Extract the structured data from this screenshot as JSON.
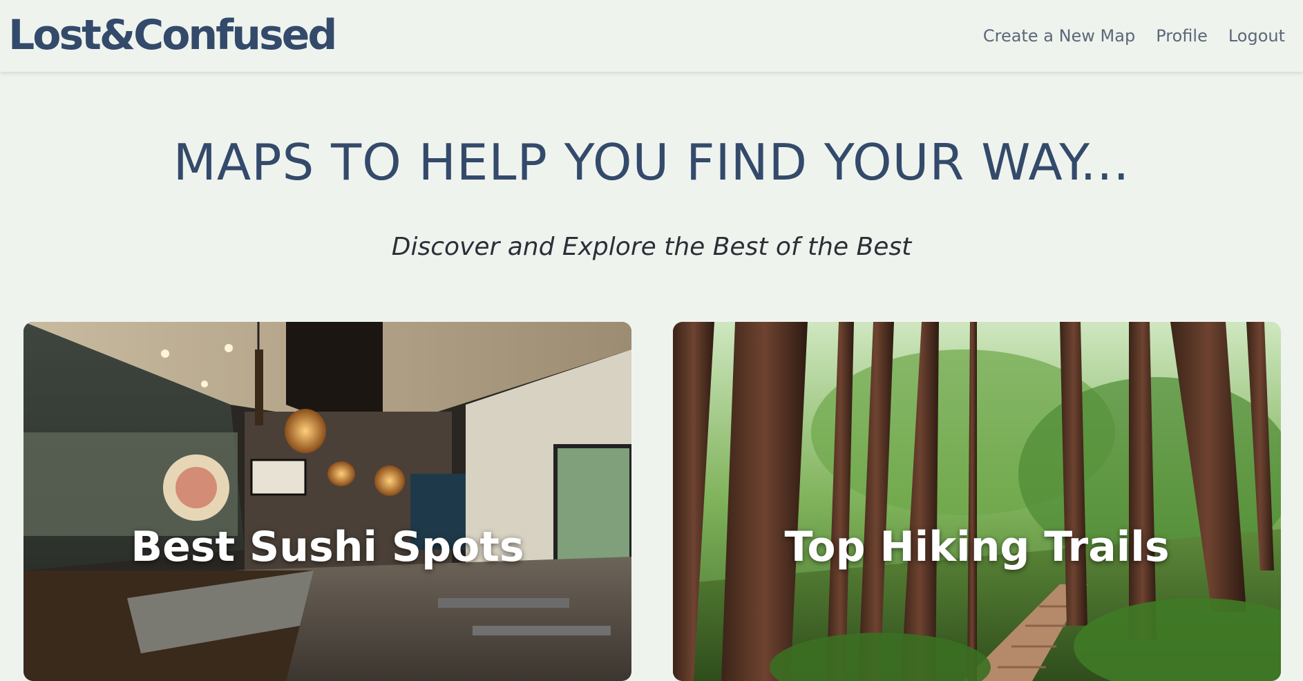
{
  "header": {
    "brand": "Lost&Confused",
    "nav": [
      {
        "label": "Create a New Map"
      },
      {
        "label": "Profile"
      },
      {
        "label": "Logout"
      }
    ]
  },
  "hero": {
    "title": "MAPS TO HELP YOU FIND YOUR WAY...",
    "subtitle": "Discover and Explore the Best of the Best"
  },
  "cards": [
    {
      "title": "Best Sushi Spots"
    },
    {
      "title": "Top Hiking Trails"
    }
  ]
}
